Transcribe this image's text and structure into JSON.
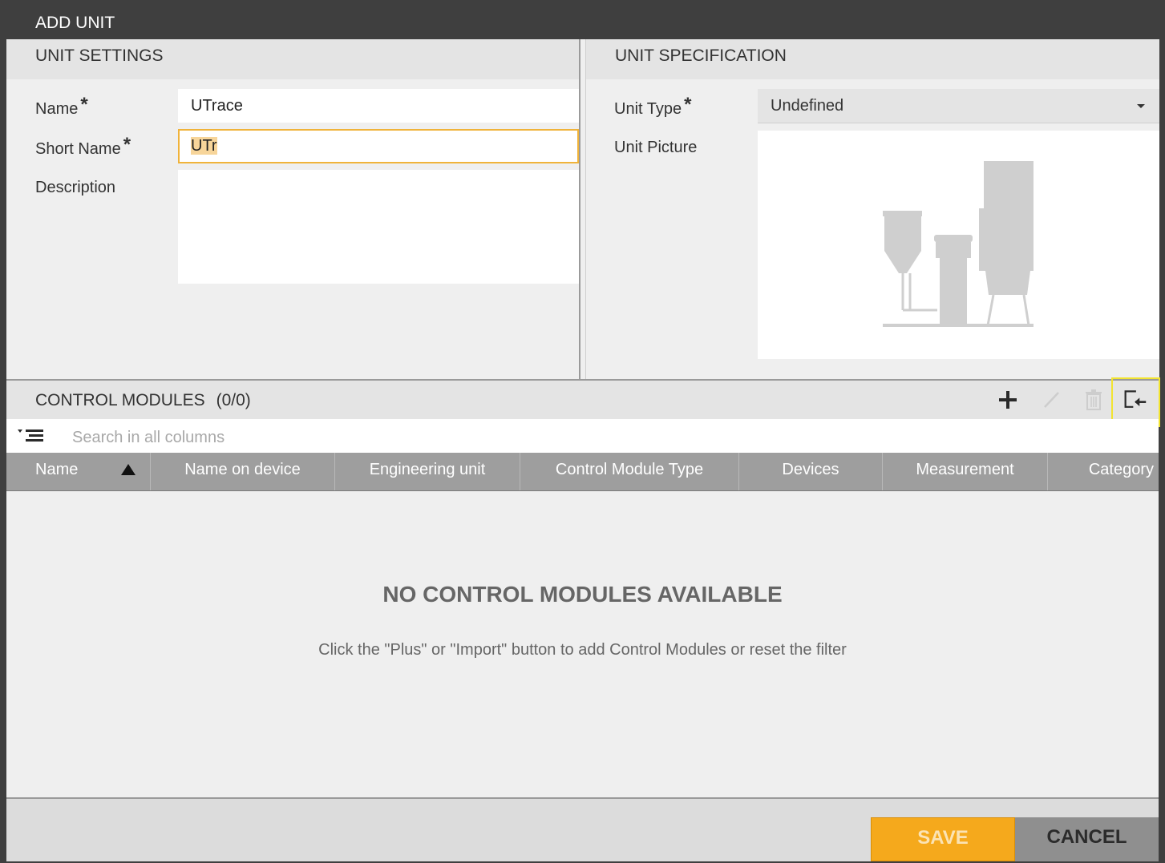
{
  "dialog": {
    "title": "ADD UNIT"
  },
  "unit_settings": {
    "heading": "UNIT SETTINGS",
    "name_label": "Name",
    "name_value": "UTrace",
    "short_name_label": "Short Name",
    "short_name_value": "UTr",
    "description_label": "Description",
    "description_value": "",
    "required_mark": "*"
  },
  "unit_specification": {
    "heading": "UNIT SPECIFICATION",
    "unit_type_label": "Unit Type",
    "unit_type_value": "Undefined",
    "unit_picture_label": "Unit Picture",
    "required_mark": "*"
  },
  "control_modules": {
    "heading": "CONTROL MODULES",
    "count": "(0/0)",
    "toolbar": {
      "add_icon": "plus-icon",
      "edit_icon": "pencil-icon",
      "delete_icon": "trash-icon",
      "import_icon": "import-icon"
    },
    "search_placeholder": "Search in all columns",
    "columns": [
      "Name",
      "Name on device",
      "Engineering unit",
      "Control Module Type",
      "Devices",
      "Measurement",
      "Category"
    ],
    "empty_title": "NO CONTROL MODULES AVAILABLE",
    "empty_text": "Click the \"Plus\" or \"Import\" button to add Control Modules or reset the filter"
  },
  "footer": {
    "save_label": "SAVE",
    "cancel_label": "CANCEL"
  },
  "colors": {
    "accent": "#f5a91c",
    "highlight": "#f2e431",
    "header_bg": "#3f3f3f"
  }
}
